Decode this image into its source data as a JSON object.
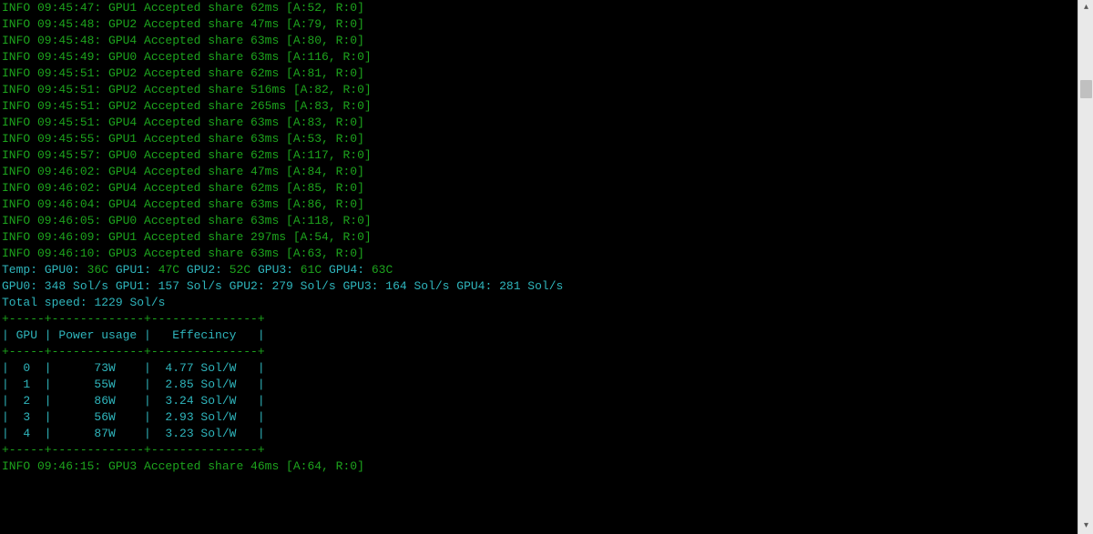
{
  "log": [
    {
      "level": "INFO",
      "time": "09:45:47",
      "gpu": "GPU1",
      "ms": "62ms",
      "a": 52,
      "r": 0
    },
    {
      "level": "INFO",
      "time": "09:45:48",
      "gpu": "GPU2",
      "ms": "47ms",
      "a": 79,
      "r": 0
    },
    {
      "level": "INFO",
      "time": "09:45:48",
      "gpu": "GPU4",
      "ms": "63ms",
      "a": 80,
      "r": 0
    },
    {
      "level": "INFO",
      "time": "09:45:49",
      "gpu": "GPU0",
      "ms": "63ms",
      "a": 116,
      "r": 0
    },
    {
      "level": "INFO",
      "time": "09:45:51",
      "gpu": "GPU2",
      "ms": "62ms",
      "a": 81,
      "r": 0
    },
    {
      "level": "INFO",
      "time": "09:45:51",
      "gpu": "GPU2",
      "ms": "516ms",
      "a": 82,
      "r": 0
    },
    {
      "level": "INFO",
      "time": "09:45:51",
      "gpu": "GPU2",
      "ms": "265ms",
      "a": 83,
      "r": 0
    },
    {
      "level": "INFO",
      "time": "09:45:51",
      "gpu": "GPU4",
      "ms": "63ms",
      "a": 83,
      "r": 0
    },
    {
      "level": "INFO",
      "time": "09:45:55",
      "gpu": "GPU1",
      "ms": "63ms",
      "a": 53,
      "r": 0
    },
    {
      "level": "INFO",
      "time": "09:45:57",
      "gpu": "GPU0",
      "ms": "62ms",
      "a": 117,
      "r": 0
    },
    {
      "level": "INFO",
      "time": "09:46:02",
      "gpu": "GPU4",
      "ms": "47ms",
      "a": 84,
      "r": 0
    },
    {
      "level": "INFO",
      "time": "09:46:02",
      "gpu": "GPU4",
      "ms": "62ms",
      "a": 85,
      "r": 0
    },
    {
      "level": "INFO",
      "time": "09:46:04",
      "gpu": "GPU4",
      "ms": "63ms",
      "a": 86,
      "r": 0
    },
    {
      "level": "INFO",
      "time": "09:46:05",
      "gpu": "GPU0",
      "ms": "63ms",
      "a": 118,
      "r": 0
    },
    {
      "level": "INFO",
      "time": "09:46:09",
      "gpu": "GPU1",
      "ms": "297ms",
      "a": 54,
      "r": 0
    },
    {
      "level": "INFO",
      "time": "09:46:10",
      "gpu": "GPU3",
      "ms": "63ms",
      "a": 63,
      "r": 0
    }
  ],
  "accepted_text": "Accepted share",
  "temp_label": "Temp:",
  "temps": [
    {
      "gpu": "GPU0",
      "val": "36C"
    },
    {
      "gpu": "GPU1",
      "val": "47C"
    },
    {
      "gpu": "GPU2",
      "val": "52C"
    },
    {
      "gpu": "GPU3",
      "val": "61C"
    },
    {
      "gpu": "GPU4",
      "val": "63C"
    }
  ],
  "hashrates_line": "GPU0: 348 Sol/s GPU1: 157 Sol/s GPU2: 279 Sol/s GPU3: 164 Sol/s GPU4: 281 Sol/s",
  "hashrates": [
    {
      "gpu": "GPU0",
      "sols": 348
    },
    {
      "gpu": "GPU1",
      "sols": 157
    },
    {
      "gpu": "GPU2",
      "sols": 279
    },
    {
      "gpu": "GPU3",
      "sols": 164
    },
    {
      "gpu": "GPU4",
      "sols": 281
    }
  ],
  "total_speed_label": "Total speed:",
  "total_speed_value": "1229 Sol/s",
  "table": {
    "rule": "+-----+-------------+---------------+",
    "header": "| GPU | Power usage |   Effecincy   |",
    "columns": [
      "GPU",
      "Power usage",
      "Effecincy"
    ],
    "rows": [
      {
        "gpu": 0,
        "power": "73W",
        "eff": "4.77 Sol/W"
      },
      {
        "gpu": 1,
        "power": "55W",
        "eff": "2.85 Sol/W"
      },
      {
        "gpu": 2,
        "power": "86W",
        "eff": "3.24 Sol/W"
      },
      {
        "gpu": 3,
        "power": "56W",
        "eff": "2.93 Sol/W"
      },
      {
        "gpu": 4,
        "power": "87W",
        "eff": "3.23 Sol/W"
      }
    ]
  },
  "trailing_log": {
    "level": "INFO",
    "time": "09:46:15",
    "gpu": "GPU3",
    "ms": "46ms",
    "a": 64,
    "r": 0
  }
}
